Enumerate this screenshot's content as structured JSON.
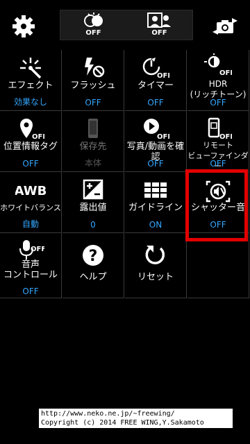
{
  "topbar": {
    "settings_icon": "gear-icon",
    "toggle1_label": "OFF",
    "toggle2_label": "OFF",
    "switch_camera_icon": "switch-camera-icon"
  },
  "grid": {
    "items": [
      {
        "label": "エフェクト",
        "value": "効果なし",
        "icon": "effect-icon"
      },
      {
        "label": "フラッシュ",
        "value": "OFF",
        "icon": "flash-off-icon"
      },
      {
        "label": "タイマー",
        "value": "OFF",
        "icon": "timer-off-icon"
      },
      {
        "label": "HDR\n(リッチトーン)",
        "value": "OFF",
        "icon": "hdr-icon"
      },
      {
        "label": "位置情報タグ",
        "value": "OFF",
        "icon": "location-tag-icon"
      },
      {
        "label": "保存先",
        "value": "本体",
        "icon": "storage-icon"
      },
      {
        "label": "写真/動画を確\n認",
        "value": "OFF",
        "icon": "review-icon"
      },
      {
        "label": "リモート\nビューファインダー",
        "value": "OFF",
        "icon": "remote-viewfinder-icon"
      },
      {
        "label": "ホワイトバランス",
        "value": "自動",
        "icon": "awb-icon"
      },
      {
        "label": "露出値",
        "value": "0",
        "icon": "exposure-icon"
      },
      {
        "label": "ガイドライン",
        "value": "ON",
        "icon": "guideline-icon"
      },
      {
        "label": "シャッター音",
        "value": "OFF",
        "icon": "shutter-sound-icon"
      },
      {
        "label": "音声\nコントロール",
        "value": "OFF",
        "icon": "voice-control-icon"
      },
      {
        "label": "ヘルプ",
        "value": "",
        "icon": "help-icon"
      },
      {
        "label": "リセット",
        "value": "",
        "icon": "reset-icon"
      }
    ]
  },
  "credit": {
    "line1": "http://www.neko.ne.jp/~freewing/",
    "line2": "Copyright (c) 2014 FREE WING,Y.Sakamoto"
  }
}
